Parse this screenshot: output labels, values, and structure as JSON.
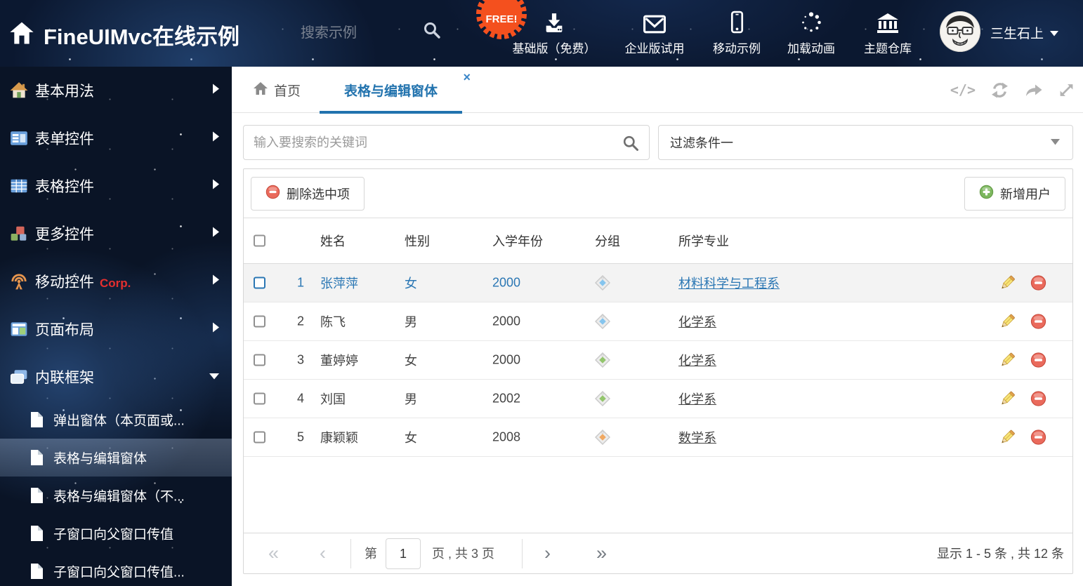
{
  "colors": {
    "accent": "#2273ae",
    "link_selected": "#2b77b4",
    "danger": "#ea6a5c",
    "success": "#7cb75e",
    "free_badge": "#f4501e"
  },
  "header": {
    "title": "FineUIMvc在线示例",
    "search_placeholder": "搜索示例",
    "free_badge": "FREE!",
    "nav": [
      {
        "label": "基础版（免费）",
        "icon": "download-icon"
      },
      {
        "label": "企业版试用",
        "icon": "envelope-icon"
      },
      {
        "label": "移动示例",
        "icon": "mobile-icon"
      },
      {
        "label": "加载动画",
        "icon": "spinner-icon"
      },
      {
        "label": "主题仓库",
        "icon": "bank-icon"
      }
    ],
    "user_name": "三生石上"
  },
  "sidebar": {
    "items": [
      {
        "label": "基本用法",
        "icon": "home"
      },
      {
        "label": "表单控件",
        "icon": "form"
      },
      {
        "label": "表格控件",
        "icon": "table"
      },
      {
        "label": "更多控件",
        "icon": "cubes"
      },
      {
        "label": "移动控件",
        "badge": "Corp.",
        "icon": "antenna"
      },
      {
        "label": "页面布局",
        "icon": "layout"
      },
      {
        "label": "内联框架",
        "icon": "frames",
        "expanded": true
      }
    ],
    "subitems": [
      {
        "label": "弹出窗体（本页面或..."
      },
      {
        "label": "表格与编辑窗体",
        "selected": true
      },
      {
        "label": "表格与编辑窗体（不..."
      },
      {
        "label": "子窗口向父窗口传值"
      },
      {
        "label": "子窗口向父窗口传值..."
      }
    ]
  },
  "tabs": {
    "home": "首页",
    "active": "表格与编辑窗体",
    "close": "×"
  },
  "filters": {
    "search_placeholder": "输入要搜索的关键词",
    "filter_value": "过滤条件一"
  },
  "toolbar": {
    "delete_label": "删除选中项",
    "add_label": "新增用户"
  },
  "table": {
    "columns": {
      "name": "姓名",
      "gender": "性别",
      "year": "入学年份",
      "group": "分组",
      "major": "所学专业"
    },
    "rows": [
      {
        "index": "1",
        "name": "张萍萍",
        "gender": "女",
        "year": "2000",
        "tag_color": "#86c5ee",
        "major": "材料科学与工程系",
        "selected": true
      },
      {
        "index": "2",
        "name": "陈飞",
        "gender": "男",
        "year": "2000",
        "tag_color": "#86c5ee",
        "major": "化学系"
      },
      {
        "index": "3",
        "name": "董婷婷",
        "gender": "女",
        "year": "2000",
        "tag_color": "#93c56d",
        "major": "化学系"
      },
      {
        "index": "4",
        "name": "刘国",
        "gender": "男",
        "year": "2002",
        "tag_color": "#93c56d",
        "major": "化学系"
      },
      {
        "index": "5",
        "name": "康颖颖",
        "gender": "女",
        "year": "2008",
        "tag_color": "#f0a963",
        "major": "数学系"
      }
    ]
  },
  "pagination": {
    "first": "«",
    "prev": "‹",
    "next": "›",
    "last": "»",
    "prefix": "第",
    "page": "1",
    "suffix": "页 , 共 3 页",
    "summary": "显示 1 - 5 条 , 共 12 条"
  }
}
